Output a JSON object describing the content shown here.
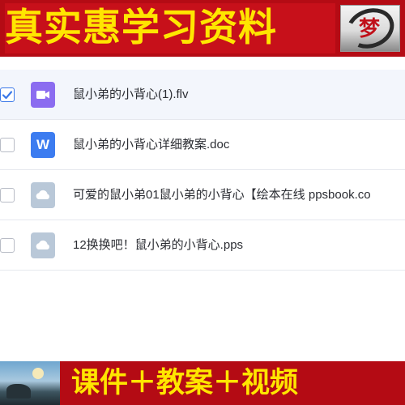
{
  "header": {
    "title": "真实惠学习资料",
    "logo_text": "梦"
  },
  "files": [
    {
      "name": "鼠小弟的小背心(1).flv",
      "icon": "video-file-icon",
      "selected": true
    },
    {
      "name": "鼠小弟的小背心详细教案.doc",
      "icon": "word-doc-icon",
      "selected": false
    },
    {
      "name": "可爱的鼠小弟01鼠小弟的小背心【绘本在线 ppsbook.co",
      "icon": "cloud-file-icon",
      "selected": false
    },
    {
      "name": "12换换吧！鼠小弟的小背心.pps",
      "icon": "cloud-file-icon",
      "selected": false
    }
  ],
  "icon_letters": {
    "word": "W"
  },
  "footer": {
    "slogan": "课件＋教案＋视频"
  },
  "colors": {
    "banner_red": "#c7101a",
    "banner_text": "#ffe600",
    "selected_check": "#3a78e8"
  }
}
